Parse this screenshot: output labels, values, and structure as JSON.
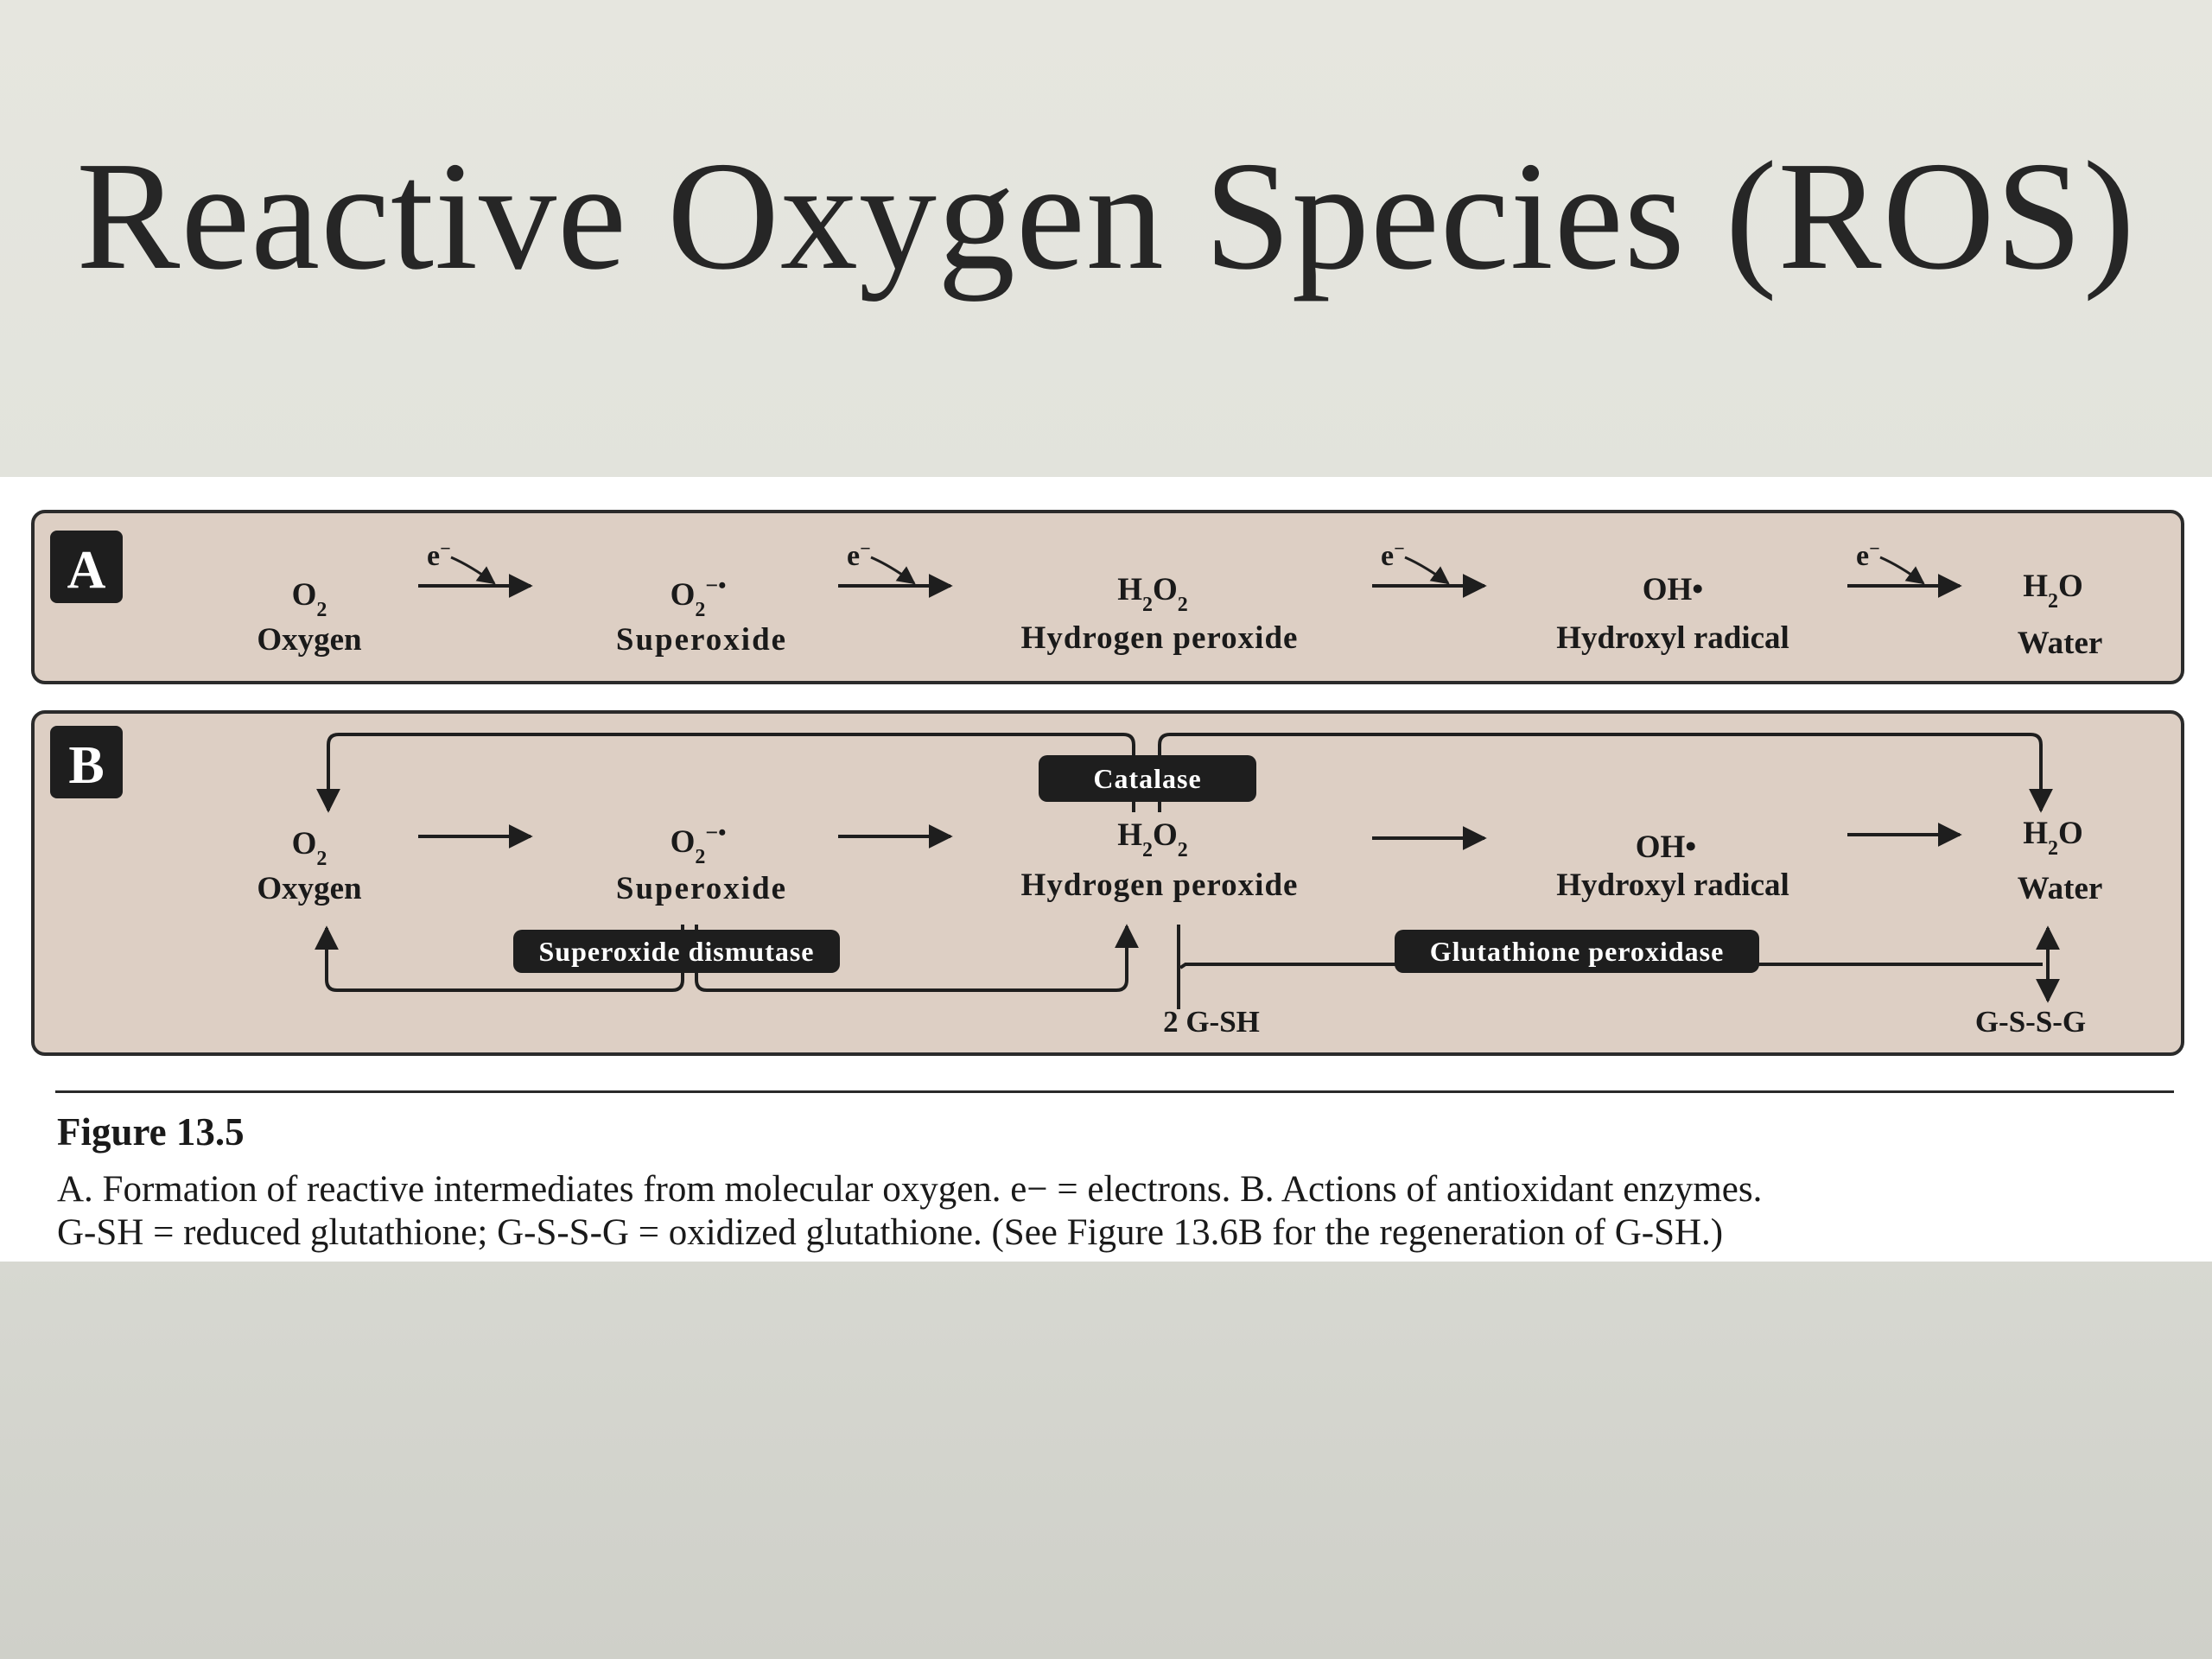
{
  "slide": {
    "title": "Reactive Oxygen Species (ROS)"
  },
  "panel_a": {
    "label": "A",
    "electron": "e",
    "electron_sup": "−",
    "species": [
      {
        "formula": "O",
        "sub": "2",
        "sup": "",
        "name": "Oxygen"
      },
      {
        "formula": "O",
        "sub": "2",
        "sup": "−•",
        "name": "Superoxide"
      },
      {
        "formula": "H",
        "sub": "2",
        "formula2": "O",
        "sub2": "2",
        "name": "Hydrogen peroxide"
      },
      {
        "formula": "OH•",
        "name": "Hydroxyl radical"
      },
      {
        "formula": "H",
        "sub": "2",
        "formula2": "O",
        "name": "Water"
      }
    ]
  },
  "panel_b": {
    "label": "B",
    "enzymes": {
      "catalase": "Catalase",
      "superoxide_dismutase": "Superoxide dismutase",
      "glutathione_peroxidase": "Glutathione peroxidase"
    },
    "gsh": "2 G-SH",
    "gssg": "G-S-S-G"
  },
  "caption": {
    "title": "Figure 13.5",
    "text_line1": "A. Formation of reactive intermediates from molecular oxygen. e− = electrons. B. Actions of antioxidant enzymes.",
    "text_line2": "G-SH = reduced glutathione; G-S-S-G = oxidized glutathione. (See Figure 13.6B for the regeneration of G-SH.)"
  },
  "colors": {
    "panel_fill": "#ddcfc4",
    "panel_stroke": "#2b2b2b",
    "enzyme_fill": "#1e1e1e",
    "enzyme_text": "#ffffff"
  }
}
